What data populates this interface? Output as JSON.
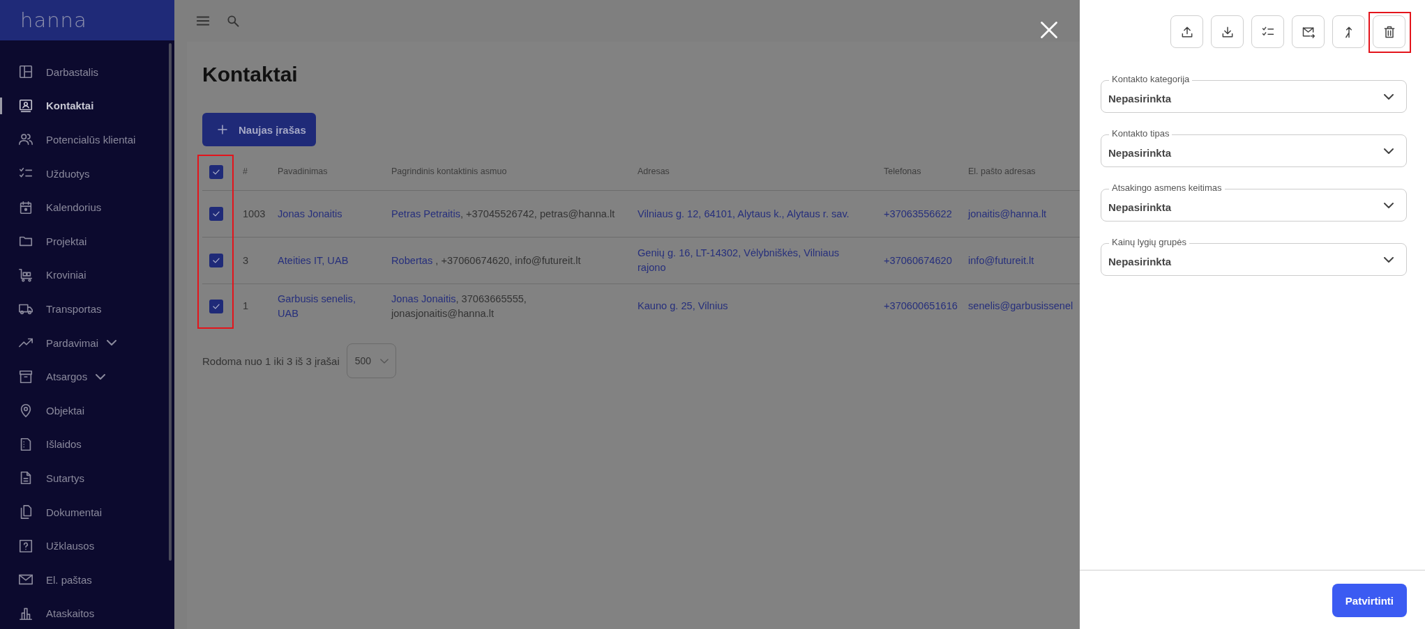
{
  "sidebar": {
    "logo": "hanna",
    "items": [
      {
        "label": "Darbastalis",
        "selected": false,
        "expandable": false
      },
      {
        "label": "Kontaktai",
        "selected": true,
        "expandable": false
      },
      {
        "label": "Potencialūs klientai",
        "selected": false,
        "expandable": false
      },
      {
        "label": "Užduotys",
        "selected": false,
        "expandable": false
      },
      {
        "label": "Kalendorius",
        "selected": false,
        "expandable": false
      },
      {
        "label": "Projektai",
        "selected": false,
        "expandable": false
      },
      {
        "label": "Kroviniai",
        "selected": false,
        "expandable": false
      },
      {
        "label": "Transportas",
        "selected": false,
        "expandable": false
      },
      {
        "label": "Pardavimai",
        "selected": false,
        "expandable": true
      },
      {
        "label": "Atsargos",
        "selected": false,
        "expandable": true
      },
      {
        "label": "Objektai",
        "selected": false,
        "expandable": false
      },
      {
        "label": "Išlaidos",
        "selected": false,
        "expandable": false
      },
      {
        "label": "Sutartys",
        "selected": false,
        "expandable": false
      },
      {
        "label": "Dokumentai",
        "selected": false,
        "expandable": false
      },
      {
        "label": "Užklausos",
        "selected": false,
        "expandable": false
      },
      {
        "label": "El. paštas",
        "selected": false,
        "expandable": false
      },
      {
        "label": "Ataskaitos",
        "selected": false,
        "expandable": false
      }
    ]
  },
  "main": {
    "title": "Kontaktai",
    "new_button": "Naujas įrašas",
    "table": {
      "select_all_checked": true,
      "checkbox_column_highlighted": true,
      "columns": [
        "#",
        "Pavadinimas",
        "Pagrindinis kontaktinis asmuo",
        "Adresas",
        "Telefonas",
        "El. pašto adresas"
      ],
      "rows": [
        {
          "checked": true,
          "number": "1003",
          "name": "Jonas Jonaitis",
          "contact_person": "Petras Petraitis",
          "contact_details": ", +37045526742, petras@hanna.lt",
          "address": "Vilniaus g. 12, 64101, Alytaus k., Alytaus r. sav.",
          "phone": "+37063556622",
          "email": "jonaitis@hanna.lt"
        },
        {
          "checked": true,
          "number": "3",
          "name": "Ateities IT, UAB",
          "contact_person": "Robertas",
          "contact_details": " , +37060674620, info@futureit.lt",
          "address": "Genių g. 16, LT-14302, Vėlybniškės, Vilniaus rajono",
          "phone": "+37060674620",
          "email": "info@futureit.lt"
        },
        {
          "checked": true,
          "number": "1",
          "name": "Garbusis senelis, UAB",
          "contact_person": "Jonas Jonaitis",
          "contact_details": ", 37063665555, jonasjonaitis@hanna.lt",
          "address": "Kauno g. 25, Vilnius",
          "phone": "+370600651616",
          "email": "senelis@garbusissenel"
        }
      ]
    },
    "pagination": {
      "summary": "Rodoma nuo 1 iki 3 iš 3 įrašai",
      "page_size": "500"
    }
  },
  "panel": {
    "actions": [
      {
        "highlighted": false
      },
      {
        "highlighted": false
      },
      {
        "highlighted": false
      },
      {
        "highlighted": false
      },
      {
        "highlighted": false
      },
      {
        "highlighted": true
      }
    ],
    "fields": [
      {
        "label": "Kontakto kategorija",
        "value": "Nepasirinkta"
      },
      {
        "label": "Kontakto tipas",
        "value": "Nepasirinkta"
      },
      {
        "label": "Atsakingo asmens keitimas",
        "value": "Nepasirinkta"
      },
      {
        "label": "Kainų lygių grupės",
        "value": "Nepasirinkta"
      }
    ],
    "confirm_button": "Patvirtinti"
  }
}
